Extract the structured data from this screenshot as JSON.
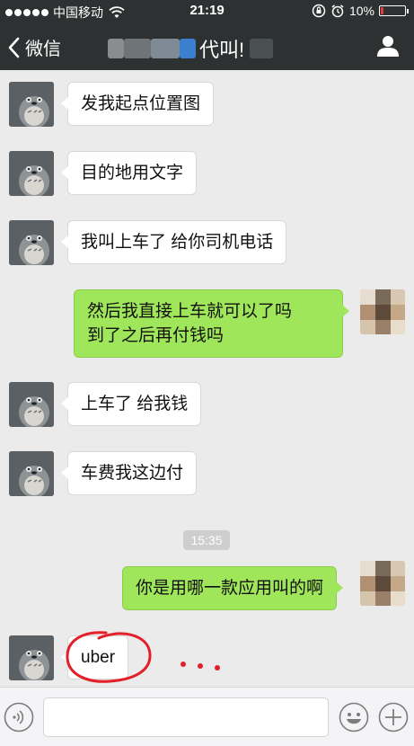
{
  "status_bar": {
    "carrier": "中国移动",
    "time": "21:19",
    "battery_percent": "10%",
    "battery_level": 0.1,
    "icons": [
      "signal-dots-icon",
      "wifi-icon",
      "rotation-lock-icon",
      "alarm-icon",
      "battery-icon"
    ]
  },
  "nav": {
    "back_label": "微信",
    "title": "代叫!",
    "icons": [
      "chevron-left-icon",
      "profile-icon"
    ]
  },
  "messages": [
    {
      "side": "left",
      "text": "发我起点位置图"
    },
    {
      "side": "left",
      "text": "目的地用文字"
    },
    {
      "side": "left",
      "text": "我叫上车了 给你司机电话"
    },
    {
      "side": "right",
      "lines": [
        "然后我直接上车就可以了吗",
        "到了之后再付钱吗"
      ]
    },
    {
      "side": "left",
      "text": "上车了 给我钱"
    },
    {
      "side": "left",
      "text": "车费我这边付"
    },
    {
      "side": "right",
      "text": "你是用哪一款应用叫的啊"
    },
    {
      "side": "left",
      "text": "uber"
    }
  ],
  "timestamp": "15:35",
  "colors": {
    "bar_bg": "#2e3132",
    "chat_bg": "#ebebeb",
    "right_bubble": "#9fe65a",
    "annotation_red": "#e3202a"
  },
  "input": {
    "placeholder": "",
    "value": ""
  }
}
